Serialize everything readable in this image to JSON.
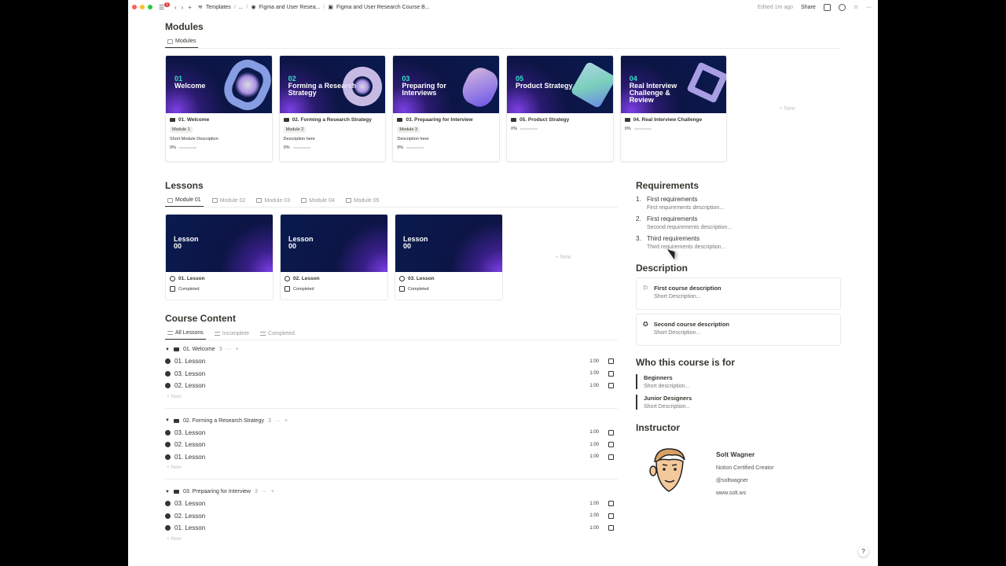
{
  "topbar": {
    "notification_count": "1",
    "crumbs": [
      "Templates",
      "...",
      "Figma and User Resea...",
      "Figma and User Research Course B..."
    ],
    "edited": "Edited 1m ago",
    "share": "Share"
  },
  "modules": {
    "title": "Modules",
    "view_tab": "Modules",
    "new_label": "New",
    "cards": [
      {
        "num": "01",
        "cover_title": "Welcome",
        "name": "01. Welcome",
        "tag": "Module 1",
        "desc": "Short Module Description",
        "progress": "0%"
      },
      {
        "num": "02",
        "cover_title": "Forming a Research Strategy",
        "name": "02. Forming a Research Strategy",
        "tag": "Module 2",
        "desc": "Description here",
        "progress": "0%"
      },
      {
        "num": "03",
        "cover_title": "Preparing for Interviews",
        "name": "03. Prepaaring for Interview",
        "tag": "Module 3",
        "desc": "Description here",
        "progress": "0%"
      },
      {
        "num": "05",
        "cover_title": "Product Strategy",
        "name": "05. Product Strategy",
        "tag": "",
        "desc": "",
        "progress": "0%"
      },
      {
        "num": "04",
        "cover_title": "Real Interview Challenge & Review",
        "name": "04. Real Interview Challenge",
        "tag": "",
        "desc": "",
        "progress": "0%"
      }
    ]
  },
  "lessons": {
    "title": "Lessons",
    "tabs": [
      "Module 01",
      "Module 02",
      "Module 03",
      "Module 04",
      "Module 05"
    ],
    "new_label": "New",
    "cards": [
      {
        "cover": "Lesson\n00",
        "name": "01. Lesson",
        "status": "Completed"
      },
      {
        "cover": "Lesson\n00",
        "name": "02. Lesson",
        "status": "Completed"
      },
      {
        "cover": "Lesson\n00",
        "name": "03. Lesson",
        "status": "Completed"
      }
    ]
  },
  "course_content": {
    "title": "Course Content",
    "tabs": [
      "All Lessons",
      "Incomplete",
      "Completed"
    ],
    "new_label": "New",
    "groups": [
      {
        "name": "01. Welcome",
        "count": "3",
        "rows": [
          {
            "name": "01. Lesson",
            "dur": "1:00"
          },
          {
            "name": "03. Lesson",
            "dur": "1:00"
          },
          {
            "name": "02. Lesson",
            "dur": "1:00"
          }
        ]
      },
      {
        "name": "02. Forming a Research Strategy",
        "count": "3",
        "rows": [
          {
            "name": "03. Lesson",
            "dur": "1:00"
          },
          {
            "name": "02. Lesson",
            "dur": "1:00"
          },
          {
            "name": "01. Lesson",
            "dur": "1:00"
          }
        ]
      },
      {
        "name": "03. Prepaaring for Interview",
        "count": "3",
        "rows": [
          {
            "name": "03. Lesson",
            "dur": "1:00"
          },
          {
            "name": "02. Lesson",
            "dur": "1:00"
          },
          {
            "name": "01. Lesson",
            "dur": "1:00"
          }
        ]
      }
    ]
  },
  "requirements": {
    "title": "Requirements",
    "items": [
      {
        "n": "1.",
        "title": "First requirements",
        "desc": "First requirements description..."
      },
      {
        "n": "2.",
        "title": "First requirements",
        "desc": "Second requirements description..."
      },
      {
        "n": "3.",
        "title": "Third requirements",
        "desc": "Third requirements description..."
      }
    ]
  },
  "description": {
    "title": "Description",
    "items": [
      {
        "title": "First course description",
        "desc": "Short Description..."
      },
      {
        "title": "Second course description",
        "desc": "Short Description..."
      }
    ]
  },
  "audience": {
    "title": "Who this course is for",
    "items": [
      {
        "title": "Beginners",
        "desc": "Short description..."
      },
      {
        "title": "Junior Designers",
        "desc": "Short Description..."
      }
    ]
  },
  "instructor": {
    "title": "Instructor",
    "name": "Solt Wagner",
    "role": "Notion Certified Creator",
    "handle": "@soltwagner",
    "site": "www.solt.ws"
  },
  "help": "?"
}
